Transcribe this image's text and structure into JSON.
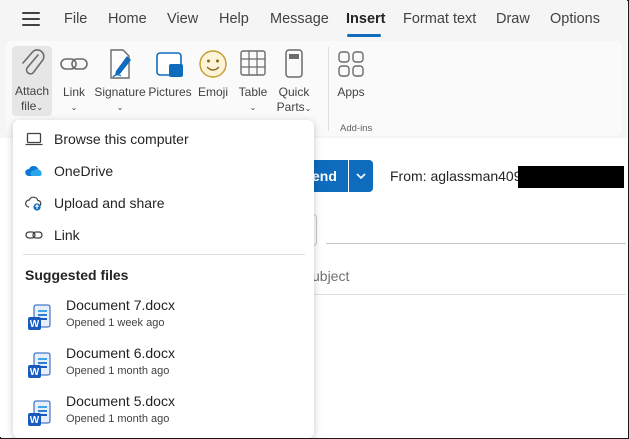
{
  "menu_tabs": [
    {
      "label": "File"
    },
    {
      "label": "Home"
    },
    {
      "label": "View"
    },
    {
      "label": "Help"
    },
    {
      "label": "Message"
    },
    {
      "label": "Insert"
    },
    {
      "label": "Format text"
    },
    {
      "label": "Draw"
    },
    {
      "label": "Options"
    }
  ],
  "active_tab": "Insert",
  "ribbon": {
    "attach_file": {
      "line1": "Attach",
      "line2": "file"
    },
    "link": {
      "line1": "Link"
    },
    "signature": {
      "line1": "Signature"
    },
    "pictures": {
      "line1": "Pictures"
    },
    "emoji": {
      "line1": "Emoji"
    },
    "table": {
      "line1": "Table"
    },
    "quick_parts": {
      "line1": "Quick",
      "line2": "Parts"
    },
    "apps": {
      "line1": "Apps"
    },
    "addins_group_label": "Add-ins"
  },
  "attach_menu": {
    "items": [
      {
        "label": "Browse this computer",
        "icon": "laptop-icon"
      },
      {
        "label": "OneDrive",
        "icon": "onedrive-cloud-icon"
      },
      {
        "label": "Upload and share",
        "icon": "cloud-upload-icon"
      },
      {
        "label": "Link",
        "icon": "link-icon"
      }
    ],
    "suggested_heading": "Suggested files",
    "suggested_files": [
      {
        "name": "Document 7.docx",
        "meta": "Opened 1 week ago"
      },
      {
        "name": "Document 6.docx",
        "meta": "Opened 1 month ago"
      },
      {
        "name": "Document 5.docx",
        "meta": "Opened 1 month ago"
      }
    ]
  },
  "compose": {
    "send_label": "end",
    "from_label": "From: aglassman409",
    "subject_placeholder": "ubject"
  },
  "colors": {
    "accent": "#0f6cbd",
    "word_blue": "#185abd",
    "onedrive_blue": "#0f78d4"
  }
}
